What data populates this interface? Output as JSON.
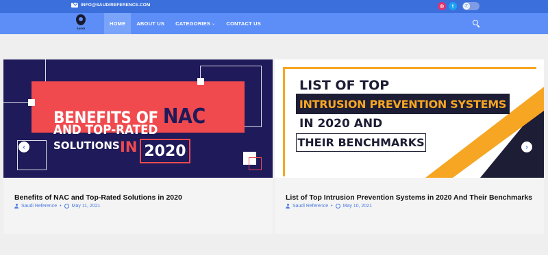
{
  "topbar": {
    "email": "INFO@SAUDIREFERENCE.COM",
    "social": [
      "instagram-icon",
      "twitter-icon"
    ],
    "toggle": "whatsapp-toggle"
  },
  "logo": {
    "text": "SAUDI"
  },
  "nav": {
    "items": [
      {
        "label": "HOME",
        "active": true
      },
      {
        "label": "ABOUT US"
      },
      {
        "label": "CATEGORIES"
      },
      {
        "label": "CONTACT US"
      }
    ]
  },
  "posts": [
    {
      "image": {
        "line1": "BENEFITS OF",
        "line1_accent": "NAC",
        "line2": "AND TOP-RATED",
        "line3": "SOLUTIONS",
        "line3_accent": "IN",
        "year": "2020"
      },
      "title": "Benefits of NAC and Top-Rated Solutions in 2020",
      "author": "Saudi Reference",
      "date": "May 11, 2021"
    },
    {
      "image": {
        "line1": "LIST OF TOP",
        "line2": "INTRUSION PREVENTION SYSTEMS",
        "line3": "IN 2020 AND",
        "line4": "THEIR BENCHMARKS"
      },
      "title": "List of Top Intrusion Prevention Systems in 2020 And Their Benchmarks",
      "author": "Saudi Reference",
      "date": "May 10, 2021"
    }
  ],
  "colors": {
    "topbar": "#3b6fdc",
    "navbar": "#5d8ef8",
    "accent_red": "#f04a4f",
    "accent_orange": "#f6a623",
    "dark_navy": "#1f1a5a"
  }
}
